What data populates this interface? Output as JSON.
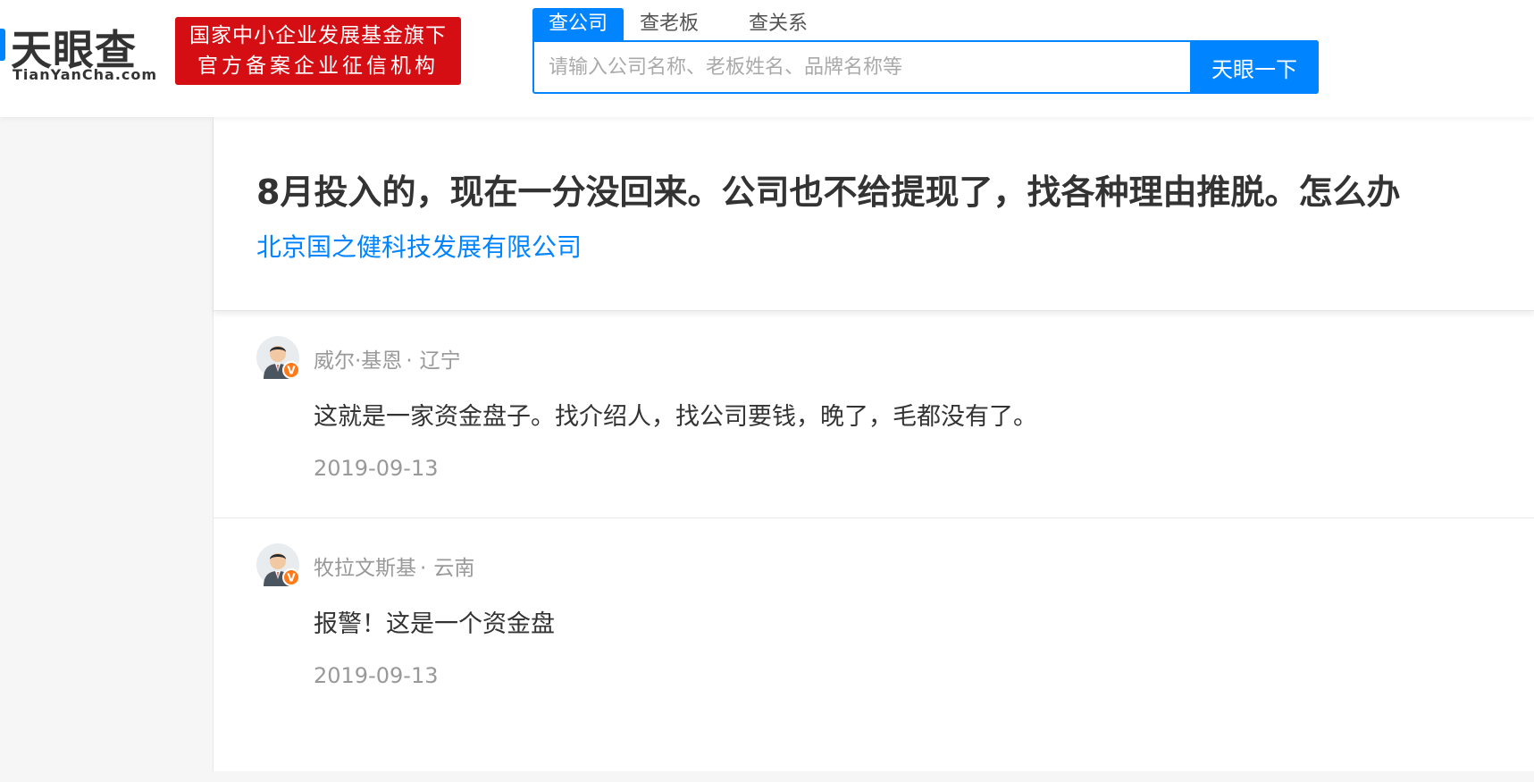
{
  "header": {
    "logo_cn": "天眼查",
    "logo_en": "TianYanCha.com",
    "badge_line1": "国家中小企业发展基金旗下",
    "badge_line2": "官方备案企业征信机构"
  },
  "search": {
    "tabs": [
      {
        "label": "查公司",
        "active": true
      },
      {
        "label": "查老板",
        "active": false
      },
      {
        "label": "查关系",
        "active": false
      }
    ],
    "placeholder": "请输入公司名称、老板姓名、品牌名称等",
    "button_label": "天眼一下"
  },
  "question": {
    "title": "8月投入的，现在一分没回来。公司也不给提现了，找各种理由推脱。怎么办",
    "company": "北京国之健科技发展有限公司"
  },
  "answers": [
    {
      "author": "威尔·基恩",
      "separator": "·",
      "location": "辽宁",
      "content": "这就是一家资金盘子。找介绍人，找公司要钱，晚了，毛都没有了。",
      "date": "2019-09-13",
      "badge": "V"
    },
    {
      "author": "牧拉文斯基",
      "separator": "·",
      "location": "云南",
      "content": "报警！这是一个资金盘",
      "date": "2019-09-13",
      "badge": "V"
    }
  ],
  "colors": {
    "brand_blue": "#0084ff",
    "badge_red": "#d50e14",
    "verified_orange": "#ff7a18"
  }
}
